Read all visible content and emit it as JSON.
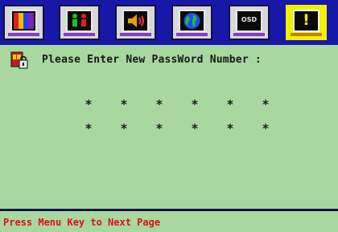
{
  "tabs": [
    {
      "icon": "color-bars-icon",
      "active": false
    },
    {
      "icon": "people-icon",
      "active": false
    },
    {
      "icon": "speaker-icon",
      "active": false
    },
    {
      "icon": "globe-icon",
      "active": false
    },
    {
      "icon": "osd-icon",
      "label": "OSD",
      "active": false
    },
    {
      "icon": "exclamation-icon",
      "label": "!",
      "active": true
    }
  ],
  "panel": {
    "icon": "lock-icon",
    "prompt": "Please Enter New PassWord Number :",
    "password_rows": [
      [
        "*",
        "*",
        "*",
        "*",
        "*",
        "*"
      ],
      [
        "*",
        "*",
        "*",
        "*",
        "*",
        "*"
      ]
    ]
  },
  "footer": {
    "hint": "Press Menu Key to Next Page"
  },
  "colors": {
    "tab_bar": "#1818a8",
    "active_tab": "#f0f000",
    "panel_bg": "#a8d8a0",
    "footer_text": "#e01010"
  }
}
